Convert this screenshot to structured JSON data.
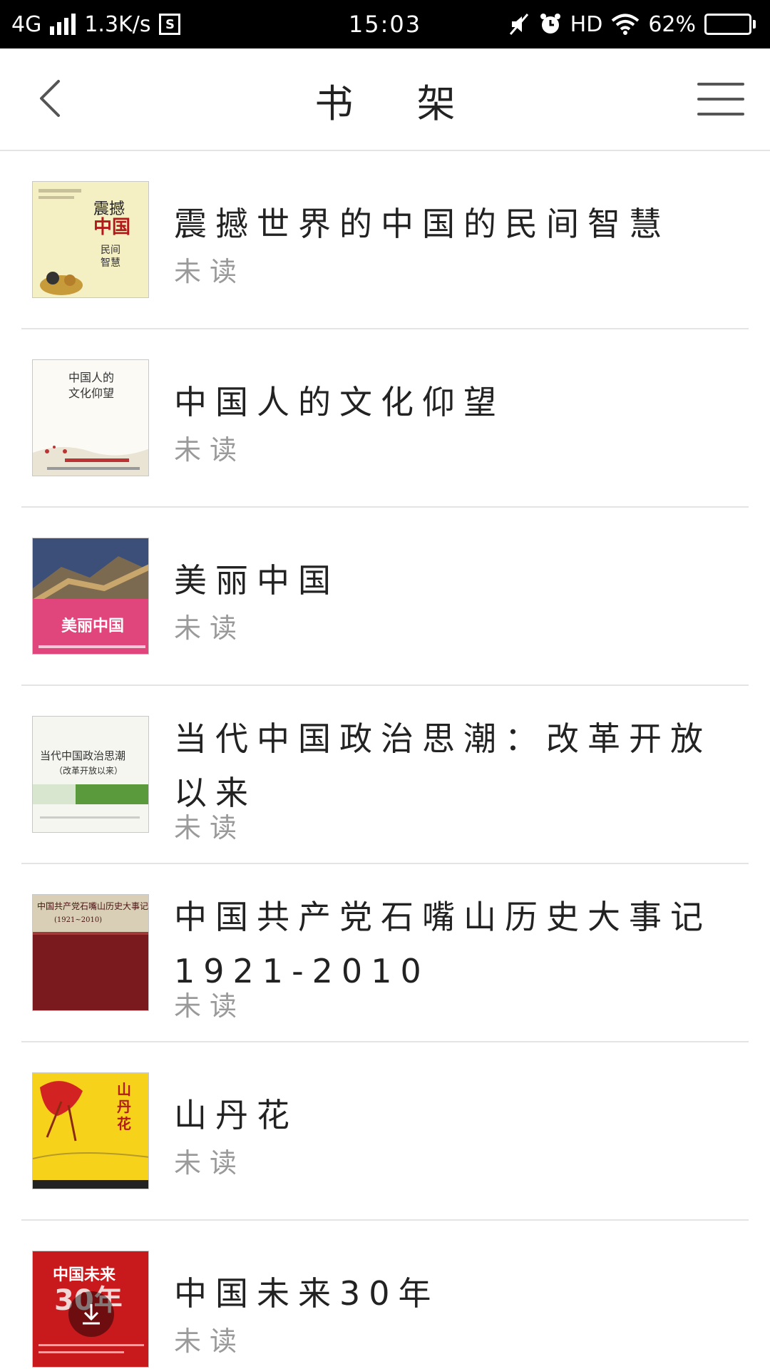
{
  "status_bar": {
    "network": "4G",
    "speed": "1.3K/s",
    "time": "15:03",
    "hd": "HD",
    "battery": "62%",
    "battery_level": 0.62
  },
  "header": {
    "title": "书 架",
    "back_icon": "chevron-left-icon",
    "menu_icon": "hamburger-menu-icon"
  },
  "books": [
    {
      "title": "震撼世界的中国的民间智慧",
      "status": "未读",
      "cover_text": "中国"
    },
    {
      "title": "中国人的文化仰望",
      "status": "未读",
      "cover_text": "中国人的文化仰望"
    },
    {
      "title": "美丽中国",
      "status": "未读",
      "cover_text": "美丽中国"
    },
    {
      "title": "当代中国政治思潮：改革开放以来",
      "status": "未读",
      "cover_text": "当代中国政治思潮"
    },
    {
      "title": "中国共产党石嘴山历史大事记1921-2010",
      "status": "未读",
      "cover_text": "中国共产党石嘴山历史大事记"
    },
    {
      "title": "山丹花",
      "status": "未读",
      "cover_text": "山丹花"
    },
    {
      "title": "中国未来30年",
      "status": "未读",
      "cover_text": "中国未来30年"
    }
  ],
  "colors": {
    "status_bar_bg": "#000000",
    "divider": "#e4e4e4",
    "status_text": "#9a9a9a"
  }
}
